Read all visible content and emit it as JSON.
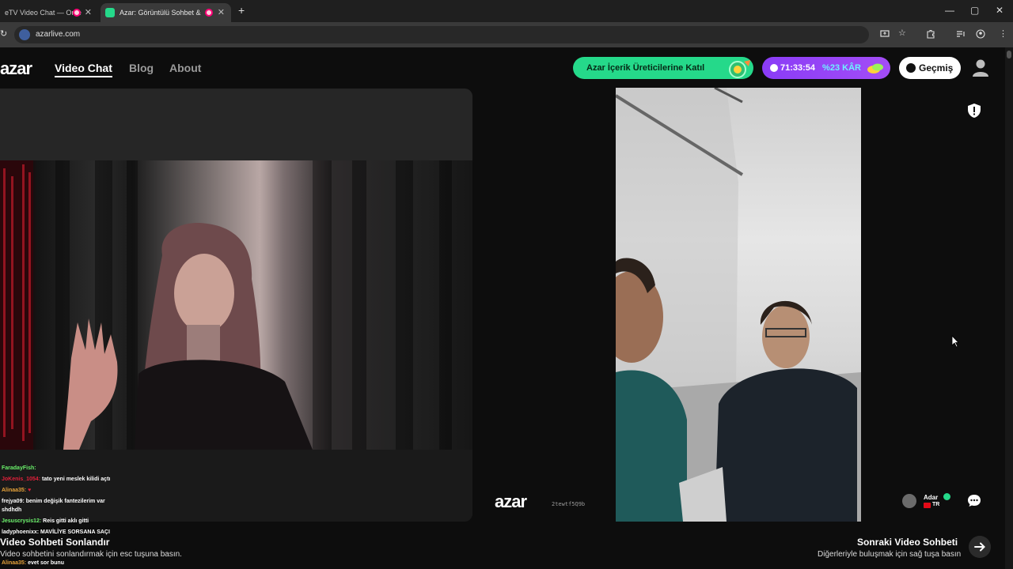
{
  "browser": {
    "tabs": [
      {
        "title": "eTV Video Chat — Ome",
        "active": false
      },
      {
        "title": "Azar: Görüntülü Sohbet & ",
        "active": true
      }
    ],
    "new_tab_symbol": "+",
    "close_symbol": "✕",
    "window_controls": [
      "—",
      "▢",
      "✕"
    ],
    "address": "azarlive.com",
    "toolbar_icons": [
      "screen-share-icon",
      "star-icon",
      "extensions-icon",
      "media-icon",
      "account-icon",
      "menu-icon"
    ]
  },
  "header": {
    "logo": "azar",
    "nav": [
      {
        "label": "Video Chat",
        "active": true
      },
      {
        "label": "Blog",
        "active": false
      },
      {
        "label": "About",
        "active": false
      }
    ],
    "creator_button": "Azar İçerik Üreticilerine Katıl",
    "timer": "71:33:54",
    "profit": "%23 KÂR",
    "history_button": "Geçmiş"
  },
  "chat_messages": [
    {
      "user": "FaradayFish:",
      "text": "",
      "user_color": "#6af06a"
    },
    {
      "user": "JoKenis_1054:",
      "text": "tato yeni meslek kilidi açtı",
      "user_color": "#e0203a"
    },
    {
      "user": "Alinaa35:",
      "text": "",
      "user_color": "#e8a33a"
    },
    {
      "user": "frejya09:",
      "text": "benim değişik fantezilerim var",
      "user_color": "#ffffff"
    },
    {
      "user": "",
      "text": "shdhdh",
      "user_color": "#ffffff"
    },
    {
      "user": "Jesuscrysis12:",
      "text": "Reis gitti aklı gitti",
      "user_color": "#6af06a"
    },
    {
      "user": "ladyphoenixx:",
      "text": "MAVİLİYE SORSANA SAÇI",
      "user_color": "#ffffff"
    },
    {
      "user": "Alinaa35:",
      "text": "evet sor bunu",
      "user_color": "#e8a33a"
    }
  ],
  "right_panel": {
    "watermark": "azar",
    "session_id": "2tewtf5Q9b",
    "peer_name": "Adar",
    "peer_country": "TR"
  },
  "footer": {
    "end_title": "Video Sohbeti Sonlandır",
    "end_hint": "Video sohbetini sonlandırmak için esc tuşuna basın.",
    "next_title": "Sonraki Video Sohbeti",
    "next_hint": "Diğerleriyle buluşmak için sağ tuşa basın"
  },
  "colors": {
    "accent_green": "#25d98a",
    "accent_purple": "#8a3cf7",
    "profit_cyan": "#6ef2ff",
    "background": "#0d0d0d"
  }
}
